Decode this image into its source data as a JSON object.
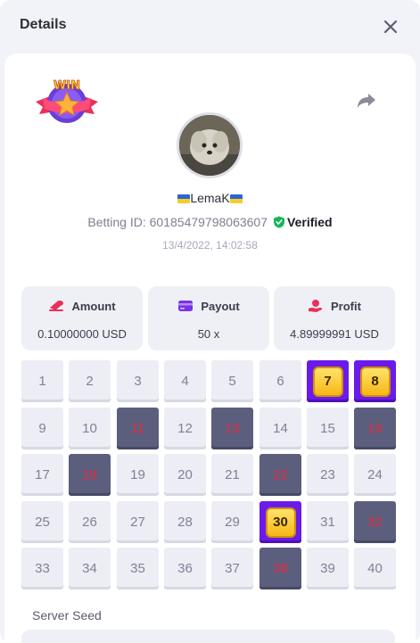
{
  "header": {
    "title": "Details"
  },
  "player": {
    "username": "LemaK",
    "betting_id_label": "Betting ID:",
    "betting_id": "60185479798063607",
    "verified_label": "Verified",
    "timestamp": "13/4/2022, 14:02:58"
  },
  "badge": {
    "text": "WIN"
  },
  "stats": {
    "amount": {
      "label": "Amount",
      "value": "0.10000000 USD"
    },
    "payout": {
      "label": "Payout",
      "value": "50 x"
    },
    "profit": {
      "label": "Profit",
      "value": "4.89999991 USD"
    }
  },
  "grid": {
    "numbers": [
      1,
      2,
      3,
      4,
      5,
      6,
      7,
      8,
      9,
      10,
      11,
      12,
      13,
      14,
      15,
      16,
      17,
      18,
      19,
      20,
      21,
      22,
      23,
      24,
      25,
      26,
      27,
      28,
      29,
      30,
      31,
      32,
      33,
      34,
      35,
      36,
      37,
      38,
      39,
      40
    ],
    "hits": [
      7,
      8,
      30
    ],
    "misses": [
      11,
      13,
      16,
      18,
      22,
      32,
      38
    ]
  },
  "seed": {
    "label": "Server Seed"
  },
  "colors": {
    "accent": "#6a1bea",
    "miss_tile": "#5b5f7d",
    "miss_text": "#e8283f",
    "verified": "#16b65a"
  },
  "icons": {
    "close": "close-icon",
    "share": "share-icon",
    "verified": "shield-check-icon",
    "amount": "coins-icon",
    "payout": "wallet-icon",
    "profit": "hand-coin-icon"
  }
}
